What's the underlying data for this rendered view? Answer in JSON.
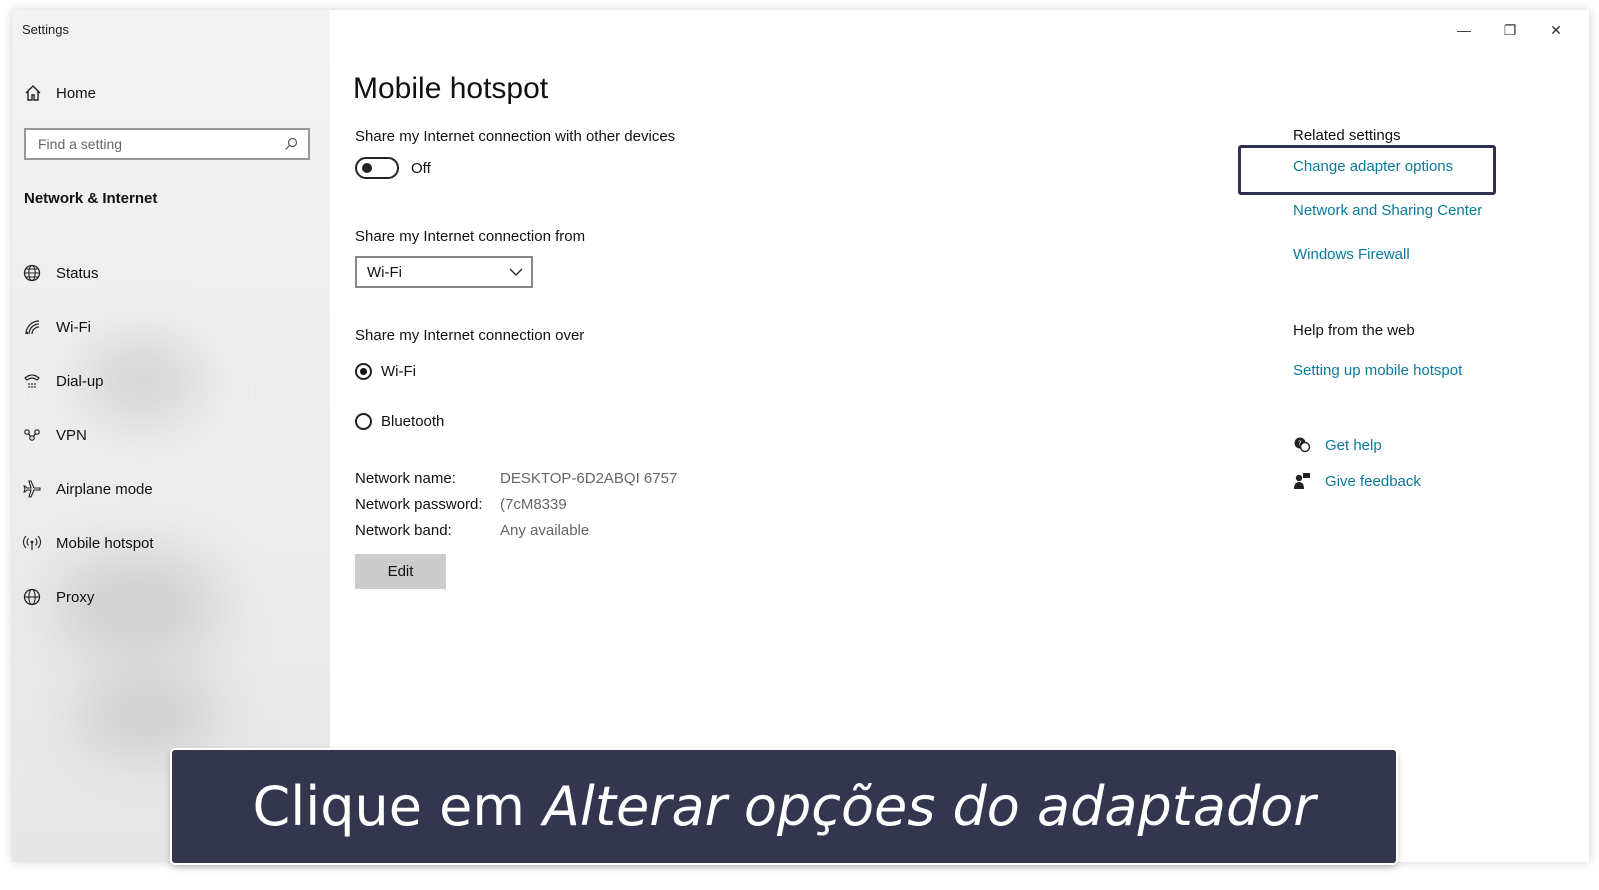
{
  "window": {
    "title": "Settings",
    "caption": {
      "minimize": "—",
      "restore": "❐",
      "close": "✕"
    }
  },
  "sidebar": {
    "home_label": "Home",
    "search_placeholder": "Find a setting",
    "section_title": "Network & Internet",
    "items": [
      {
        "label": "Status",
        "icon": "globe-status-icon"
      },
      {
        "label": "Wi-Fi",
        "icon": "wifi-icon"
      },
      {
        "label": "Dial-up",
        "icon": "dialup-icon"
      },
      {
        "label": "VPN",
        "icon": "vpn-icon"
      },
      {
        "label": "Airplane mode",
        "icon": "airplane-icon"
      },
      {
        "label": "Mobile hotspot",
        "icon": "hotspot-icon"
      },
      {
        "label": "Proxy",
        "icon": "globe-icon"
      }
    ]
  },
  "main": {
    "title": "Mobile hotspot",
    "share_label": "Share my Internet connection with other devices",
    "toggle_state": "Off",
    "from_label": "Share my Internet connection from",
    "from_value": "Wi-Fi",
    "over_label": "Share my Internet connection over",
    "radio_options": [
      {
        "label": "Wi-Fi",
        "checked": true
      },
      {
        "label": "Bluetooth",
        "checked": false
      }
    ],
    "info": {
      "name_key": "Network name:",
      "name_value": "DESKTOP-6D2ABQI 6757",
      "password_key": "Network password:",
      "password_value": "(7cM8339",
      "band_key": "Network band:",
      "band_value": "Any available"
    },
    "edit_label": "Edit"
  },
  "related": {
    "heading": "Related settings",
    "links": [
      "Change adapter options",
      "Network and Sharing Center",
      "Windows Firewall"
    ],
    "help_heading": "Help from the web",
    "help_link": "Setting up mobile hotspot",
    "get_help": "Get help",
    "give_feedback": "Give feedback",
    "link_color": "#0a7a9c",
    "highlight_color": "#2f3152"
  },
  "banner": {
    "prefix": "Clique em",
    "emphasis": "Alterar opções do adaptador",
    "background": "#34364f"
  }
}
